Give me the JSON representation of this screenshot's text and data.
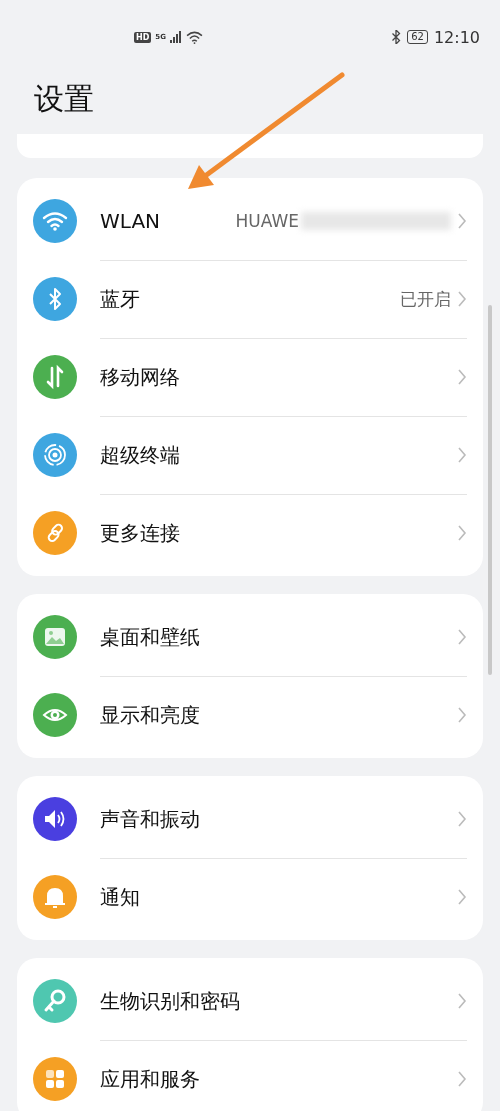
{
  "status_bar": {
    "hd": "HD",
    "network": "5G",
    "battery": "62",
    "time": "12:10"
  },
  "title": "设置",
  "groups": [
    {
      "items": [
        {
          "label": "WLAN",
          "value": "HUAWE",
          "blurred": true,
          "color": "#3ea6e0"
        },
        {
          "label": "蓝牙",
          "value": "已开启",
          "color": "#3ea6e0"
        },
        {
          "label": "移动网络",
          "color": "#4caf50"
        },
        {
          "label": "超级终端",
          "color": "#3ea6e0"
        },
        {
          "label": "更多连接",
          "color": "#f5a024"
        }
      ]
    },
    {
      "items": [
        {
          "label": "桌面和壁纸",
          "color": "#4caf50"
        },
        {
          "label": "显示和亮度",
          "color": "#4caf50"
        }
      ]
    },
    {
      "items": [
        {
          "label": "声音和振动",
          "color": "#4a3fe0"
        },
        {
          "label": "通知",
          "color": "#f5a024"
        }
      ]
    },
    {
      "items": [
        {
          "label": "生物识别和密码",
          "color": "#4fc7b0"
        },
        {
          "label": "应用和服务",
          "color": "#f5a024"
        }
      ]
    }
  ]
}
